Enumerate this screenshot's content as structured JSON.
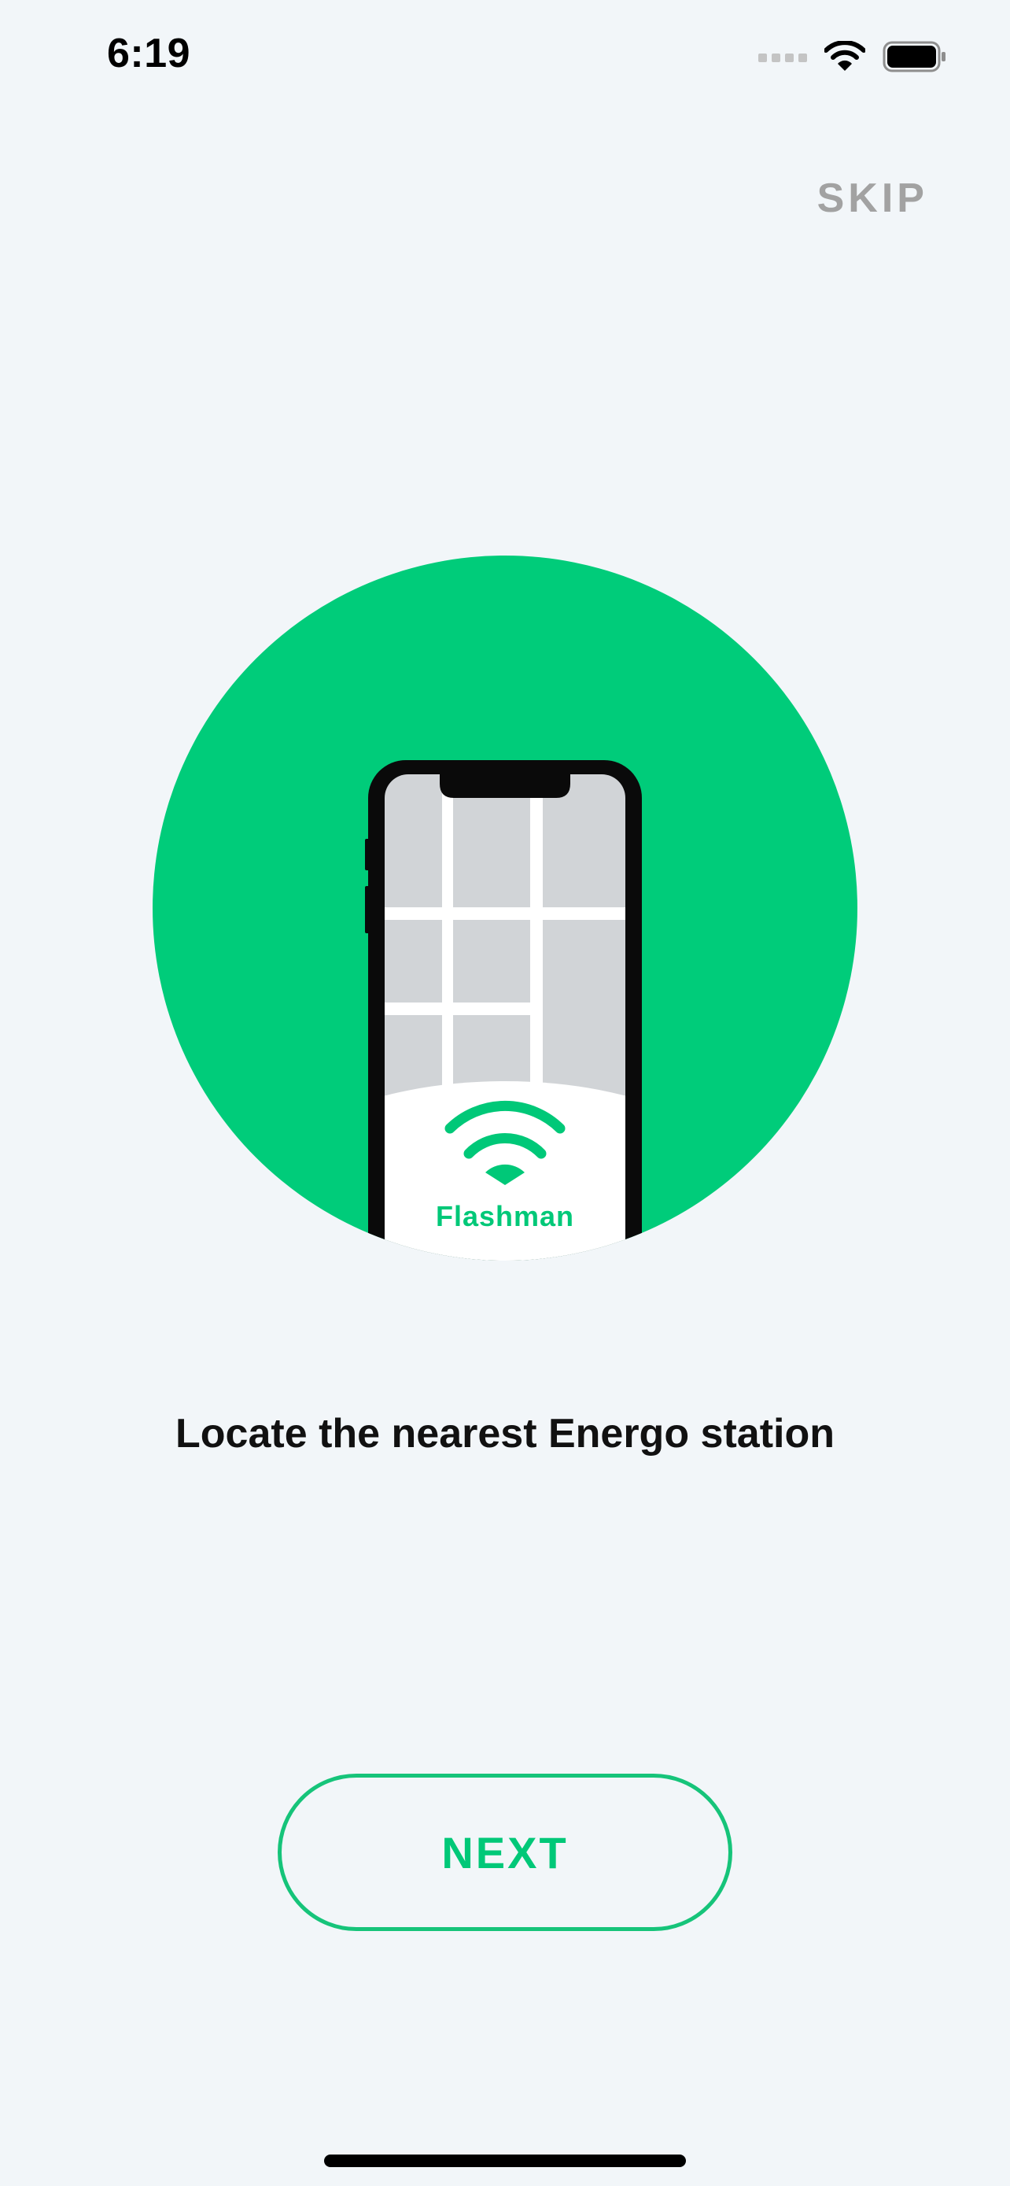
{
  "status_bar": {
    "time": "6:19",
    "icons": [
      "cellular-signal-icon",
      "wifi-icon",
      "battery-icon"
    ]
  },
  "header": {
    "skip_label": "SKIP"
  },
  "illustration": {
    "icon": "phone-map-illustration",
    "app_name": "Flashman"
  },
  "caption": "Locate the nearest Energo station",
  "next_label": "NEXT",
  "colors": {
    "background": "#f2f6f9",
    "accent": "#00cc7a",
    "skip_text": "#a2a2a2",
    "caption_text": "#111111"
  }
}
